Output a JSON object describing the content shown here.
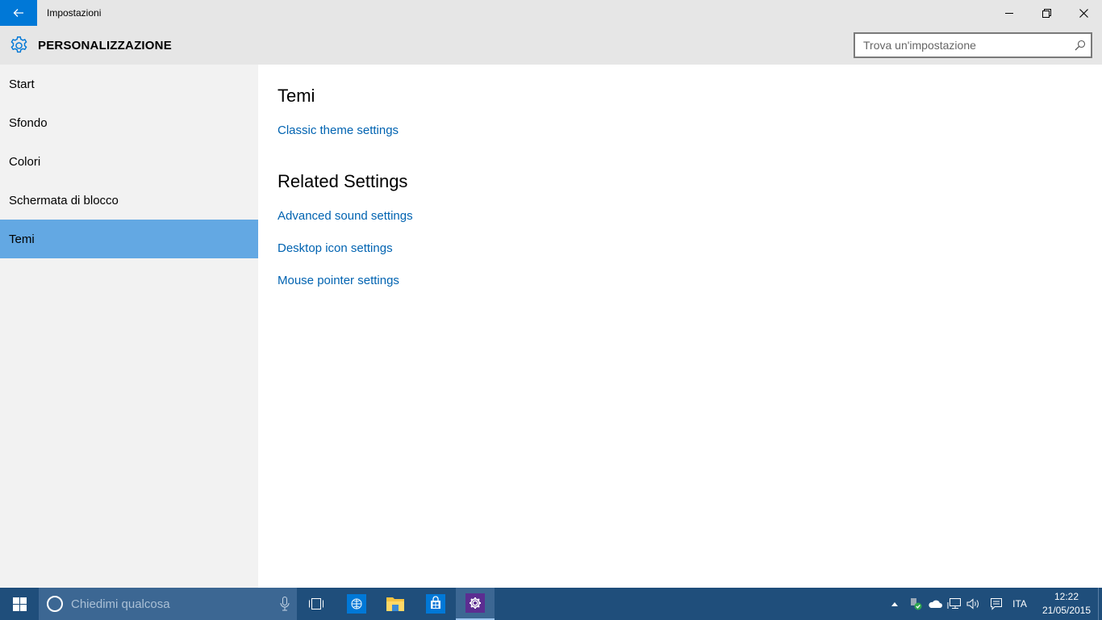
{
  "window": {
    "title": "Impostazioni"
  },
  "header": {
    "section_title": "PERSONALIZZAZIONE",
    "search_placeholder": "Trova un'impostazione"
  },
  "sidebar": {
    "items": [
      {
        "label": "Start"
      },
      {
        "label": "Sfondo"
      },
      {
        "label": "Colori"
      },
      {
        "label": "Schermata di blocco"
      },
      {
        "label": "Temi"
      }
    ],
    "selected": "Temi"
  },
  "content": {
    "themes_heading": "Temi",
    "classic_link": "Classic theme settings",
    "related_heading": "Related Settings",
    "related_links": [
      {
        "label": "Advanced sound settings"
      },
      {
        "label": "Desktop icon settings"
      },
      {
        "label": "Mouse pointer settings"
      }
    ]
  },
  "taskbar": {
    "search_placeholder": "Chiedimi qualcosa",
    "language": "ITA",
    "time": "12:22",
    "date": "21/05/2015"
  },
  "colors": {
    "accent": "#0078d7",
    "selected_nav": "#63a8e3",
    "link": "#0063b1",
    "taskbar": "#1f4e7b"
  }
}
